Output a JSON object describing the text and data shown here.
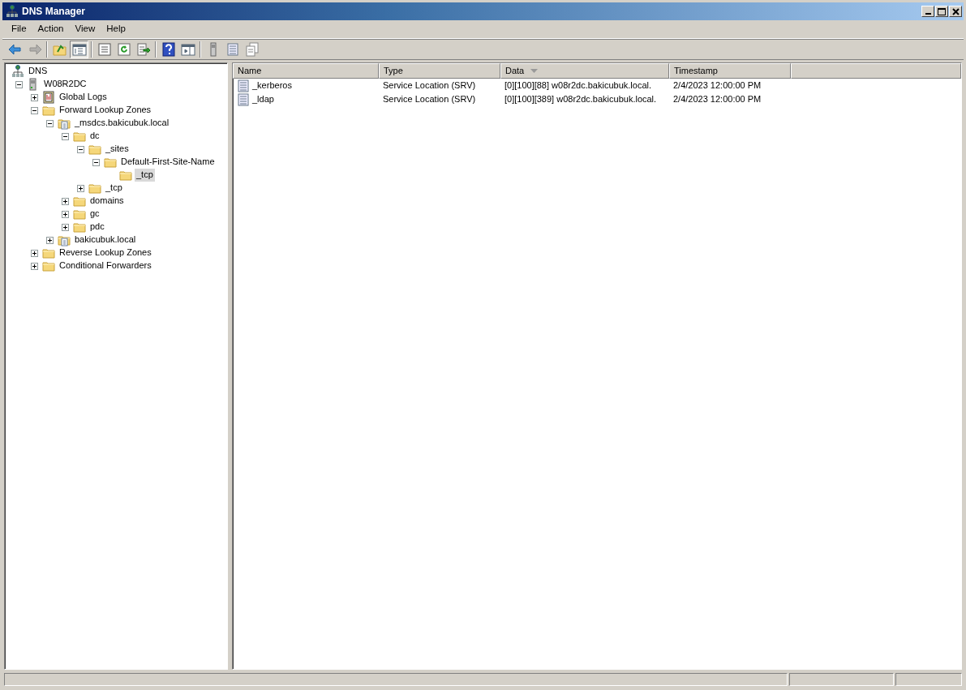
{
  "window": {
    "title": "DNS Manager"
  },
  "menu": [
    "File",
    "Action",
    "View",
    "Help"
  ],
  "toolbar": [
    {
      "kind": "back",
      "disabled": false,
      "pressed": false
    },
    {
      "kind": "forward",
      "disabled": true,
      "pressed": false
    },
    {
      "kind": "separator"
    },
    {
      "kind": "up",
      "disabled": false,
      "pressed": false
    },
    {
      "kind": "tree",
      "disabled": false,
      "pressed": true
    },
    {
      "kind": "separator"
    },
    {
      "kind": "properties",
      "disabled": false,
      "pressed": false
    },
    {
      "kind": "refresh",
      "disabled": false,
      "pressed": false
    },
    {
      "kind": "export",
      "disabled": false,
      "pressed": false
    },
    {
      "kind": "separator"
    },
    {
      "kind": "help",
      "disabled": false,
      "pressed": false
    },
    {
      "kind": "actionpane",
      "disabled": false,
      "pressed": false
    },
    {
      "kind": "separator"
    },
    {
      "kind": "server",
      "disabled": false,
      "pressed": false
    },
    {
      "kind": "list",
      "disabled": false,
      "pressed": false
    },
    {
      "kind": "copy",
      "disabled": false,
      "pressed": false
    }
  ],
  "tree": [
    {
      "label": "DNS",
      "kind": "dns",
      "expandable": false,
      "selected": false,
      "children": [
        {
          "label": "W08R2DC",
          "kind": "server",
          "expandable": true,
          "expanded": true,
          "selected": false,
          "children": [
            {
              "label": "Global Logs",
              "kind": "logs",
              "expandable": true,
              "expanded": false,
              "selected": false
            },
            {
              "label": "Forward Lookup Zones",
              "kind": "folder",
              "expandable": true,
              "expanded": true,
              "selected": false,
              "children": [
                {
                  "label": "_msdcs.bakicubuk.local",
                  "kind": "zone",
                  "expandable": true,
                  "expanded": true,
                  "selected": false,
                  "children": [
                    {
                      "label": "dc",
                      "kind": "folder",
                      "expandable": true,
                      "expanded": true,
                      "selected": false,
                      "children": [
                        {
                          "label": "_sites",
                          "kind": "folder",
                          "expandable": true,
                          "expanded": true,
                          "selected": false,
                          "children": [
                            {
                              "label": "Default-First-Site-Name",
                              "kind": "folder",
                              "expandable": true,
                              "expanded": true,
                              "selected": false,
                              "children": [
                                {
                                  "label": "_tcp",
                                  "kind": "folder",
                                  "expandable": false,
                                  "selected": true
                                }
                              ]
                            }
                          ]
                        },
                        {
                          "label": "_tcp",
                          "kind": "folder",
                          "expandable": true,
                          "expanded": false,
                          "selected": false
                        }
                      ]
                    },
                    {
                      "label": "domains",
                      "kind": "folder",
                      "expandable": true,
                      "expanded": false,
                      "selected": false
                    },
                    {
                      "label": "gc",
                      "kind": "folder",
                      "expandable": true,
                      "expanded": false,
                      "selected": false
                    },
                    {
                      "label": "pdc",
                      "kind": "folder",
                      "expandable": true,
                      "expanded": false,
                      "selected": false
                    }
                  ]
                },
                {
                  "label": "bakicubuk.local",
                  "kind": "zone",
                  "expandable": true,
                  "expanded": false,
                  "selected": false
                }
              ]
            },
            {
              "label": "Reverse Lookup Zones",
              "kind": "folder",
              "expandable": true,
              "expanded": false,
              "selected": false
            },
            {
              "label": "Conditional Forwarders",
              "kind": "folder",
              "expandable": true,
              "expanded": false,
              "selected": false
            }
          ]
        }
      ]
    }
  ],
  "table": {
    "columns": [
      {
        "label": "Name",
        "sorted": false
      },
      {
        "label": "Type",
        "sorted": false
      },
      {
        "label": "Data",
        "sorted": true
      },
      {
        "label": "Timestamp",
        "sorted": false
      }
    ],
    "rows": [
      {
        "cells": [
          "_kerberos",
          "Service Location (SRV)",
          "[0][100][88] w08r2dc.bakicubuk.local.",
          "2/4/2023 12:00:00 PM"
        ]
      },
      {
        "cells": [
          "_ldap",
          "Service Location (SRV)",
          "[0][100][389] w08r2dc.bakicubuk.local.",
          "2/4/2023 12:00:00 PM"
        ]
      }
    ]
  }
}
